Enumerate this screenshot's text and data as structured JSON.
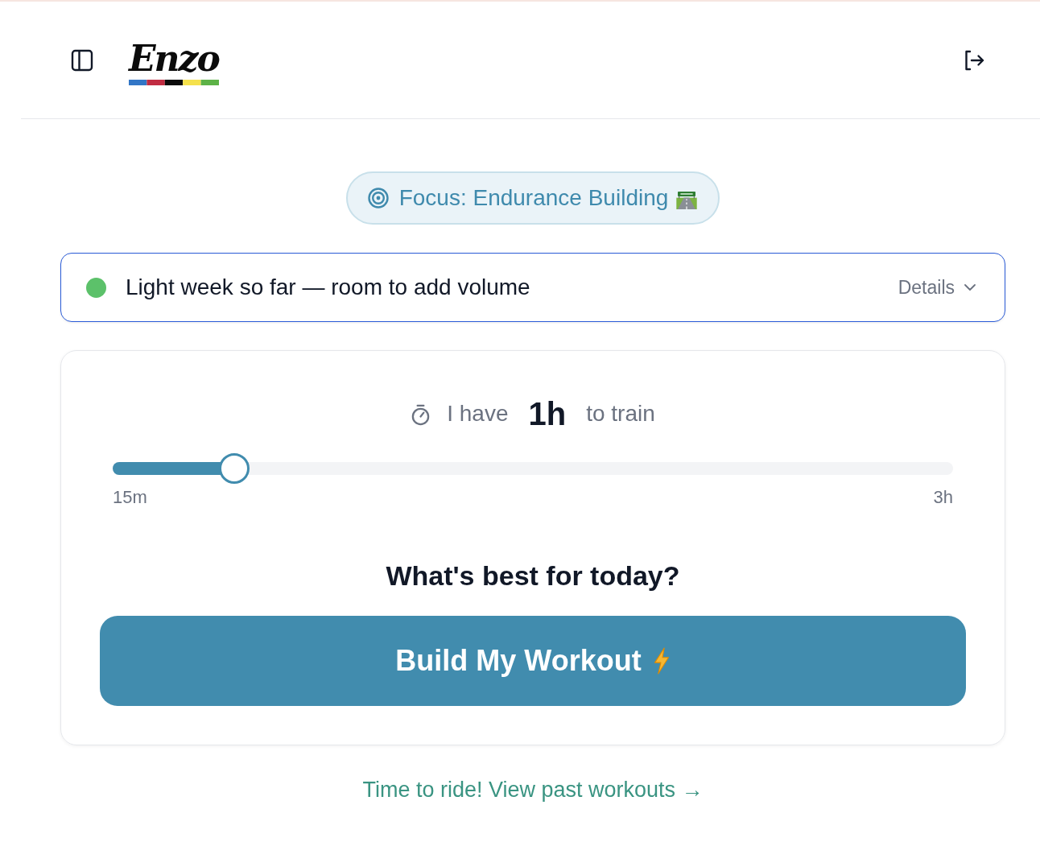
{
  "header": {
    "logo": "Enzo"
  },
  "focus": {
    "label": "Focus: Endurance Building"
  },
  "status": {
    "color": "#5cc16a",
    "message": "Light week so far — room to add volume",
    "details": "Details",
    "expanded": false
  },
  "planner": {
    "prefix": "I have",
    "duration": "1h",
    "suffix": "to train",
    "slider": {
      "level": 0.145,
      "min_label": "15m",
      "max_label": "3h"
    },
    "question": "What's best for today?",
    "button": "Build My Workout"
  },
  "footer_link": "Time to ride! View past workouts →"
}
